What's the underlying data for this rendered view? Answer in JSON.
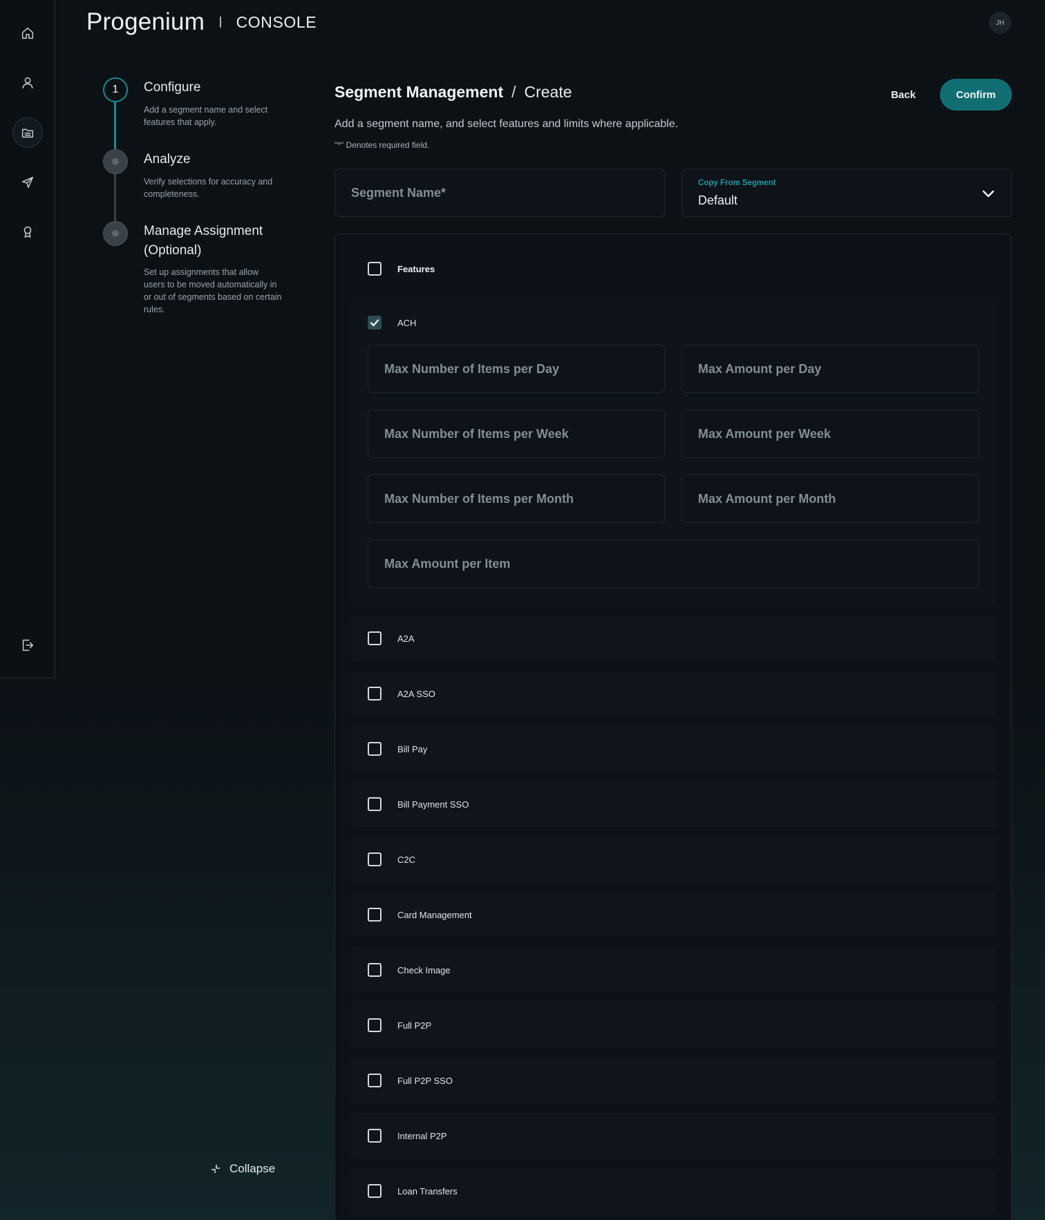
{
  "header": {
    "brand": "Progenium",
    "product": "CONSOLE",
    "avatar_initials": "JH"
  },
  "rail": {
    "items": [
      {
        "icon": "home-icon"
      },
      {
        "icon": "user-icon"
      },
      {
        "icon": "folder-icon",
        "active": true
      },
      {
        "icon": "send-icon"
      },
      {
        "icon": "award-icon"
      }
    ],
    "logout_icon": "logout-icon"
  },
  "stepper": {
    "steps": [
      {
        "number": "1",
        "title": "Configure",
        "description": "Add a segment name and select features that apply.",
        "state": "current"
      },
      {
        "title": "Analyze",
        "description": "Verify selections for accuracy and completeness.",
        "state": "todo"
      },
      {
        "title": "Manage Assignment (Optional)",
        "description": "Set up assignments that allow users to be moved automatically in or out of segments based on certain rules.",
        "state": "todo"
      }
    ],
    "collapse_label": "Collapse"
  },
  "main": {
    "title_strong": "Segment Management",
    "title_separator": "/",
    "title_crumb": "Create",
    "back_label": "Back",
    "confirm_label": "Confirm",
    "subtitle": "Add a segment name, and select features and limits where applicable.",
    "required_note": "\"*\" Denotes required field.",
    "segment_name_placeholder": "Segment Name*",
    "copy_from": {
      "label": "Copy From Segment",
      "value": "Default"
    }
  },
  "features": {
    "header_label": "Features",
    "ach": {
      "label": "ACH",
      "checked": true,
      "limits": [
        "Max Number of Items per Day",
        "Max Amount per Day",
        "Max Number of Items per Week",
        "Max Amount per Week",
        "Max Number of Items per Month",
        "Max Amount per Month",
        "Max Amount per Item"
      ]
    },
    "items": [
      "A2A",
      "A2A SSO",
      "Bill Pay",
      "Bill Payment SSO",
      "C2C",
      "Card Management",
      "Check Image",
      "Full P2P",
      "Full P2P SSO",
      "Internal P2P",
      "Loan Transfers"
    ]
  },
  "colors": {
    "accent": "#106e73",
    "accent_text": "#1a9aa1",
    "background": "#0c1116"
  }
}
